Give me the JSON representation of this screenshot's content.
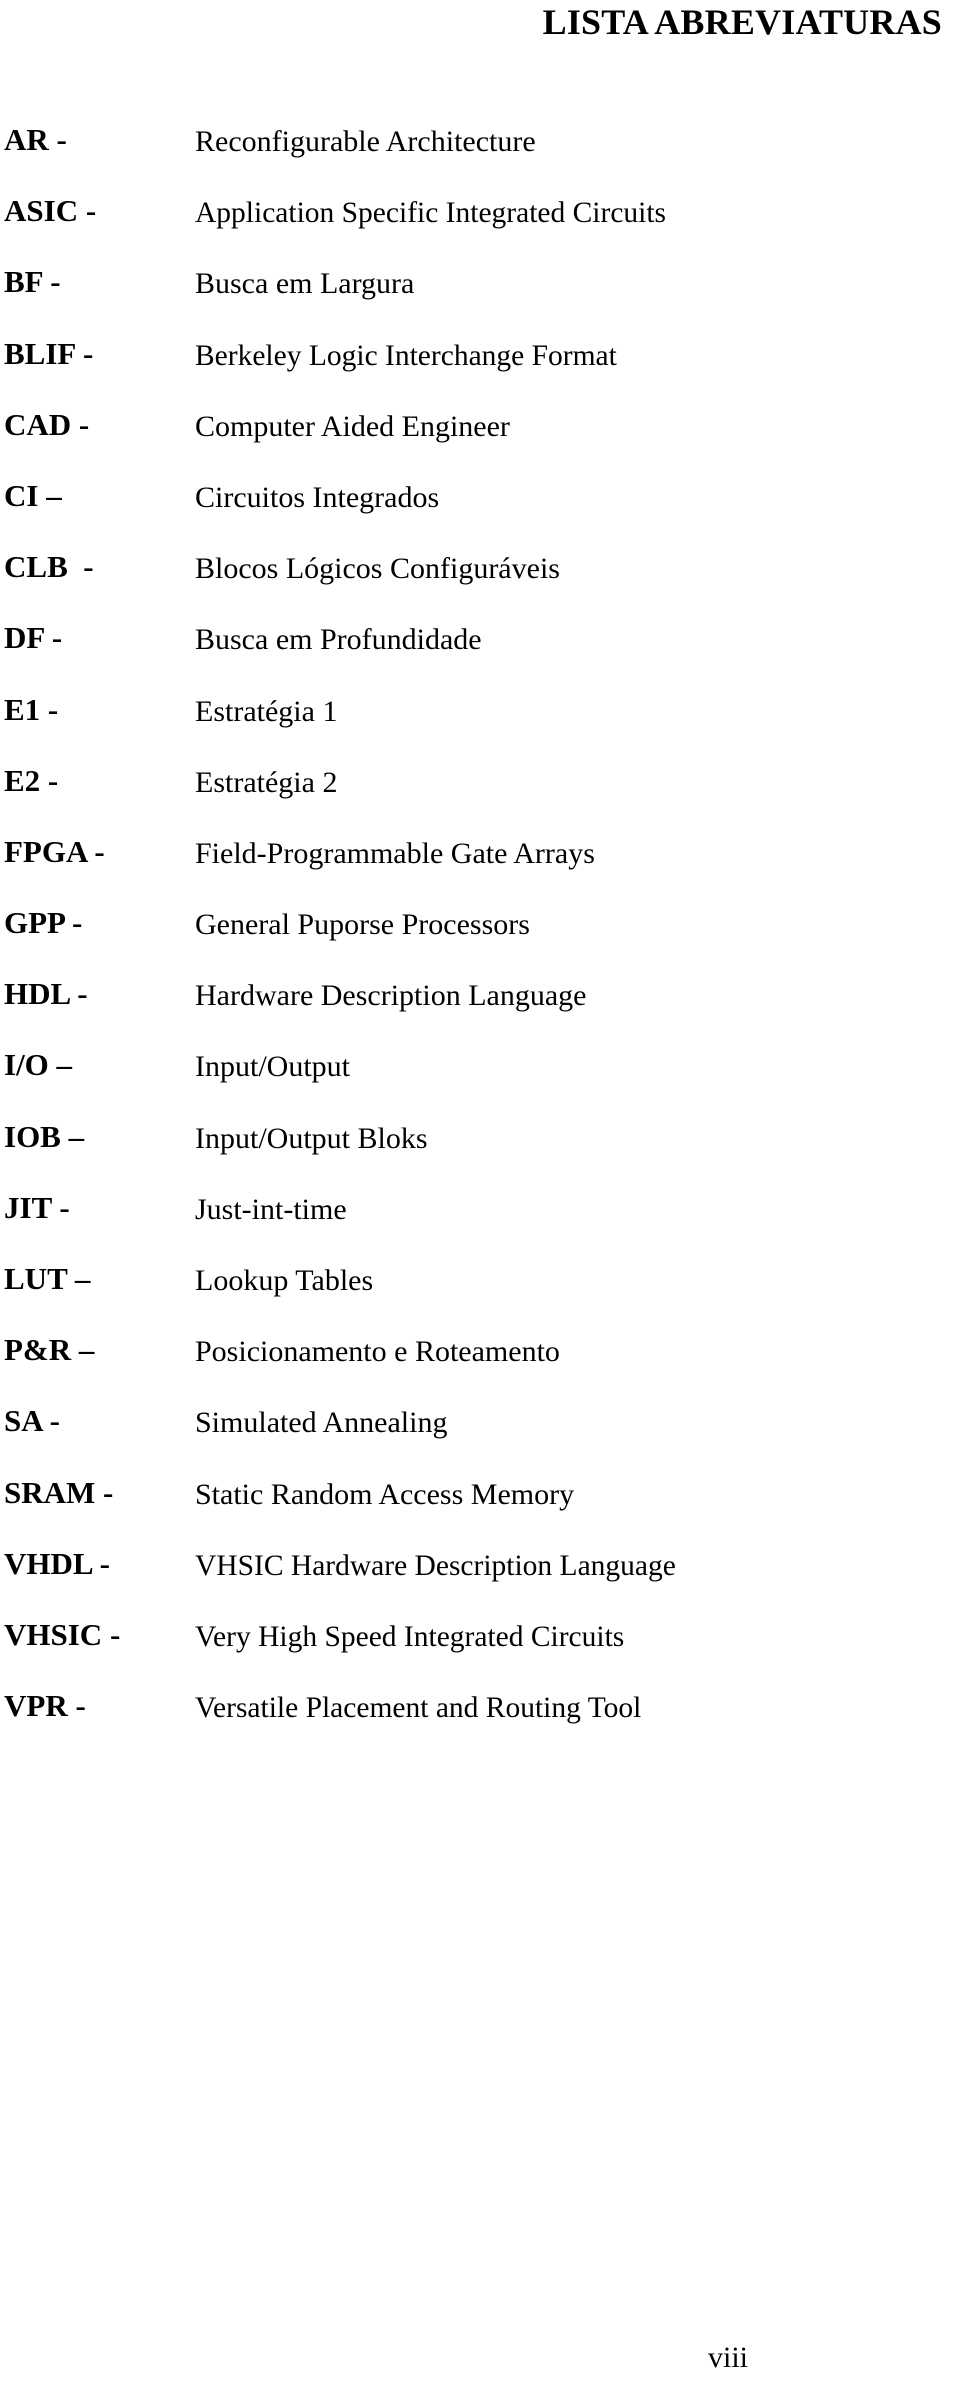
{
  "document": {
    "title": "LISTA ABREVIATURAS",
    "page_number": "viii"
  },
  "abbreviations": [
    {
      "term": "AR -",
      "definition": "Reconfigurable Architecture"
    },
    {
      "term": "ASIC -",
      "definition": "Application Specific Integrated Circuits"
    },
    {
      "term": "BF -",
      "definition": "Busca em Largura"
    },
    {
      "term": "BLIF -",
      "definition": "Berkeley Logic Interchange Format"
    },
    {
      "term": "CAD -",
      "definition": "Computer Aided Engineer"
    },
    {
      "term": "CI –",
      "definition": "Circuitos Integrados"
    },
    {
      "term": "CLB  -",
      "definition": "Blocos Lógicos Configuráveis"
    },
    {
      "term": "DF -",
      "definition": "Busca em Profundidade"
    },
    {
      "term": "E1 -",
      "definition": "Estratégia 1"
    },
    {
      "term": "E2 -",
      "definition": "Estratégia 2"
    },
    {
      "term": "FPGA -",
      "definition": "Field-Programmable Gate Arrays"
    },
    {
      "term": "GPP -",
      "definition": "General Puporse Processors"
    },
    {
      "term": "HDL -",
      "definition": "Hardware Description Language"
    },
    {
      "term": "I/O –",
      "definition": "Input/Output"
    },
    {
      "term": "IOB –",
      "definition": "Input/Output Bloks"
    },
    {
      "term": "JIT -",
      "definition": "Just-int-time"
    },
    {
      "term": "LUT –",
      "definition": "Lookup Tables"
    },
    {
      "term": "P&R –",
      "definition": "Posicionamento e Roteamento"
    },
    {
      "term": "SA -",
      "definition": "Simulated Annealing"
    },
    {
      "term": "SRAM -",
      "definition": "Static Random Access Memory"
    },
    {
      "term": "VHDL -",
      "definition": "VHSIC Hardware Description Language"
    },
    {
      "term": "VHSIC -",
      "definition": "Very High Speed Integrated Circuits"
    },
    {
      "term": "VPR -",
      "definition": "Versatile Placement and Routing Tool"
    }
  ]
}
